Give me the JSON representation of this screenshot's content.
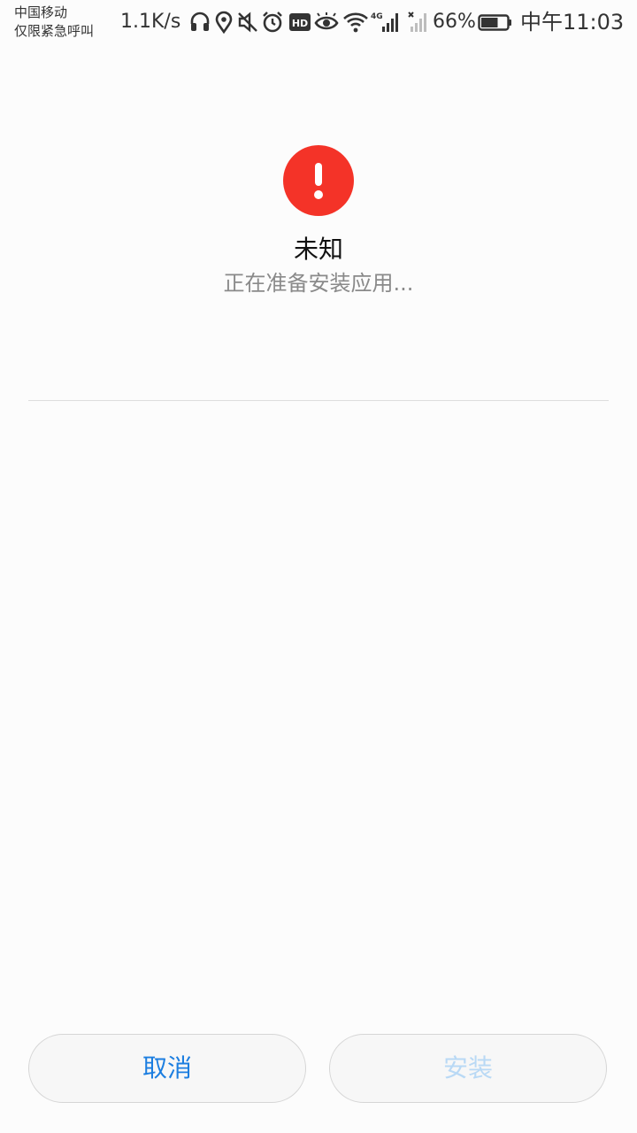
{
  "status_bar": {
    "carrier_line1": "中国移动",
    "carrier_line2": "仅限紧急呼叫",
    "net_speed": "1.1K/s",
    "network_label": "4G",
    "battery_percent": "66%",
    "battery_level": 0.66,
    "time": "中午11:03",
    "icons": [
      "headset-icon",
      "location-icon",
      "mute-icon",
      "alarm-icon",
      "hd-icon",
      "eye-icon",
      "wifi-icon",
      "signal-4g-icon",
      "signal-no-sim-icon",
      "battery-icon"
    ]
  },
  "app": {
    "icon": "exclamation-icon",
    "icon_color": "#f43328",
    "name": "未知",
    "status": "正在准备安装应用..."
  },
  "buttons": {
    "cancel": "取消",
    "install": "安装",
    "cancel_color": "#1c7ee0",
    "install_color_disabled": "#b9d9f5"
  }
}
